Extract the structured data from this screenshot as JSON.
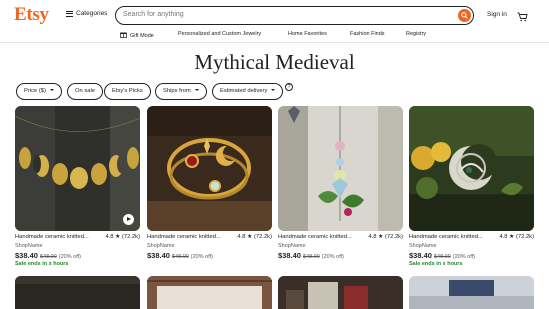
{
  "header": {
    "logo": "Etsy",
    "categories_label": "Categories",
    "search_placeholder": "Search for anything",
    "signin_label": "Sign in"
  },
  "subnav": {
    "items": [
      "Gift Mode",
      "Personalized and Custom Jewelry",
      "Home Favorites",
      "Fashion Finds",
      "Registry"
    ]
  },
  "page_title": "Mythical Medieval",
  "filters": {
    "price": "Price ($)",
    "on_sale": "On sale",
    "picks": "Etsy's Picks",
    "ships_from": "Ships from",
    "delivery": "Estimated delivery",
    "help": "?"
  },
  "products": [
    {
      "title": "Handmade ceramic knitted...",
      "rating": "4.8",
      "reviews": "(72.2k)",
      "shop": "ShopName",
      "price": "$38.40",
      "original": "$48.00",
      "discount": "(20% off)",
      "sale_note": "Sale ends in x hours"
    },
    {
      "title": "Handmade ceramic knitted...",
      "rating": "4.8",
      "reviews": "(72.2k)",
      "shop": "ShopName",
      "price": "$38.40",
      "original": "$48.00",
      "discount": "(20% off)",
      "sale_note": ""
    },
    {
      "title": "Handmade ceramic knitted...",
      "rating": "4.8",
      "reviews": "(72.2k)",
      "shop": "ShopName",
      "price": "$38.40",
      "original": "$48.00",
      "discount": "(20% off)",
      "sale_note": ""
    },
    {
      "title": "Handmade ceramic knitted...",
      "rating": "4.8",
      "reviews": "(72.2k)",
      "shop": "ShopName",
      "price": "$38.40",
      "original": "$48.00",
      "discount": "(20% off)",
      "sale_note": "Sale ends in x hours"
    }
  ],
  "colors": {
    "brand": "#f1641e",
    "sale_green": "#258635"
  },
  "icons": [
    "hamburger-icon",
    "search-icon",
    "cart-icon",
    "gift-icon",
    "play-icon",
    "star-icon",
    "help-icon"
  ]
}
